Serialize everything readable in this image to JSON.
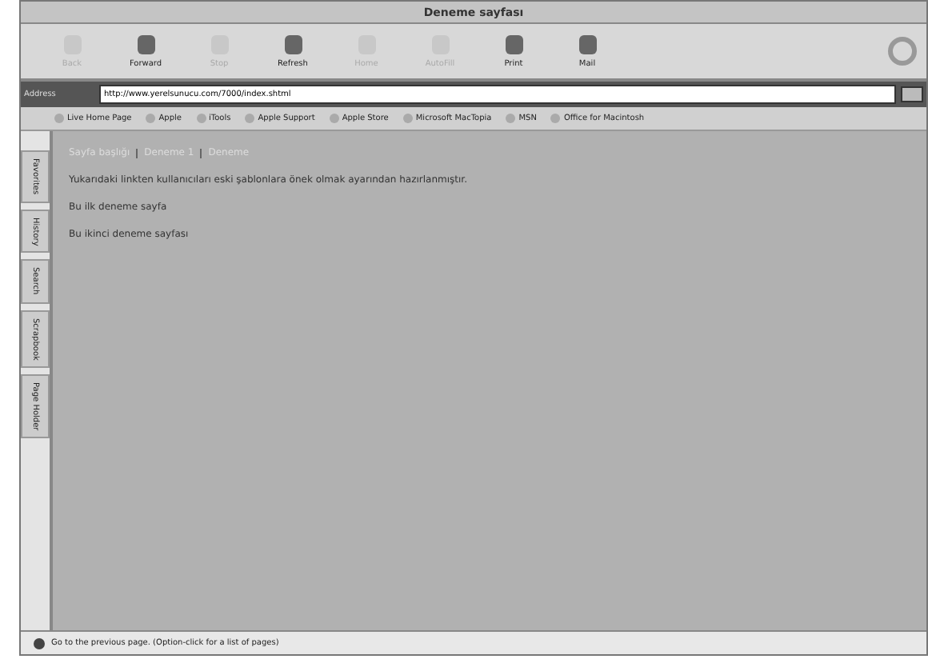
{
  "window": {
    "title": "Deneme sayfası"
  },
  "toolbar": [
    {
      "label": "Back",
      "disabled": true
    },
    {
      "label": "Forward",
      "disabled": false
    },
    {
      "label": "Stop",
      "disabled": true
    },
    {
      "label": "Refresh",
      "disabled": false
    },
    {
      "label": "Home",
      "disabled": true
    },
    {
      "label": "AutoFill",
      "disabled": true
    },
    {
      "label": "Print",
      "disabled": false
    },
    {
      "label": "Mail",
      "disabled": false
    }
  ],
  "address": {
    "label": "Address",
    "value": "http://www.yerelsunucu.com/7000/index.shtml"
  },
  "favorites": [
    "Live Home Page",
    "Apple",
    "iTools",
    "Apple Support",
    "Apple Store",
    "Microsoft MacTopia",
    "MSN",
    "Office for Macintosh"
  ],
  "side_tabs": [
    "Favorites",
    "History",
    "Search",
    "Scrapbook",
    "Page Holder"
  ],
  "content": {
    "breadcrumb": [
      "Sayfa başlığı",
      "Deneme 1",
      "Deneme"
    ],
    "paragraphs": [
      "Yukarıdaki linkten kullanıcıları eski şablonlara önek olmak ayarından hazırlanmıştır.",
      "Bu ilk deneme sayfa",
      "Bu ikinci deneme sayfası"
    ]
  },
  "status_bar": "Go to the previous page. (Option-click for a list of pages)"
}
